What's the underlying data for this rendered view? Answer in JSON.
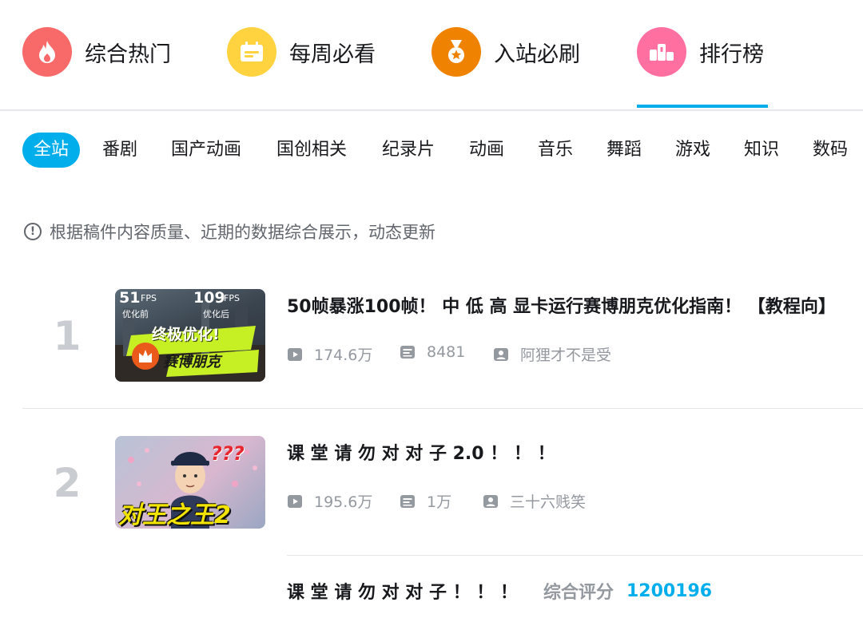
{
  "nav": {
    "items": [
      {
        "label": "综合热门",
        "icon": "flame-icon",
        "color": "#f86a6a"
      },
      {
        "label": "每周必看",
        "icon": "calendar-icon",
        "color": "#ffd23f"
      },
      {
        "label": "入站必刷",
        "icon": "medal-icon",
        "color": "#ef8300"
      },
      {
        "label": "排行榜",
        "icon": "podium-icon",
        "color": "#ff6fa0"
      }
    ],
    "active_index": 3
  },
  "categories": [
    "全站",
    "番剧",
    "国产动画",
    "国创相关",
    "纪录片",
    "动画",
    "音乐",
    "舞蹈",
    "游戏",
    "知识",
    "数码"
  ],
  "active_category": "全站",
  "notice": "根据稿件内容质量、近期的数据综合展示，动态更新",
  "ranking": [
    {
      "rank": "1",
      "title": "50帧暴涨100帧！ 中 低 高 显卡运行赛博朋克优化指南！ 【教程向】",
      "views": "174.6万",
      "danmaku": "8481",
      "author": "阿狸才不是受",
      "thumb_text": {
        "fps_left": "51",
        "fps_left_unit": "FPS",
        "fps_left_note": "优化前",
        "fps_right": "109",
        "fps_right_unit": "FPS",
        "fps_right_note": "优化后",
        "headline": "终极优化!",
        "sub": "赛博朋克"
      }
    },
    {
      "rank": "2",
      "title": "课 堂 请 勿 对 对 子 2.0 ！ ！ ！",
      "views": "195.6万",
      "danmaku": "1万",
      "author": "三十六贱笑",
      "thumb_text": {
        "headline": "对王之王2",
        "marks": "???"
      }
    }
  ],
  "related": {
    "title": "课 堂 请 勿 对 对 子 ！ ！ ！",
    "score_label": "综合评分",
    "score_value": "1200196"
  },
  "colors": {
    "accent": "#00aeec",
    "text": "#18191c",
    "muted": "#9499a0"
  }
}
